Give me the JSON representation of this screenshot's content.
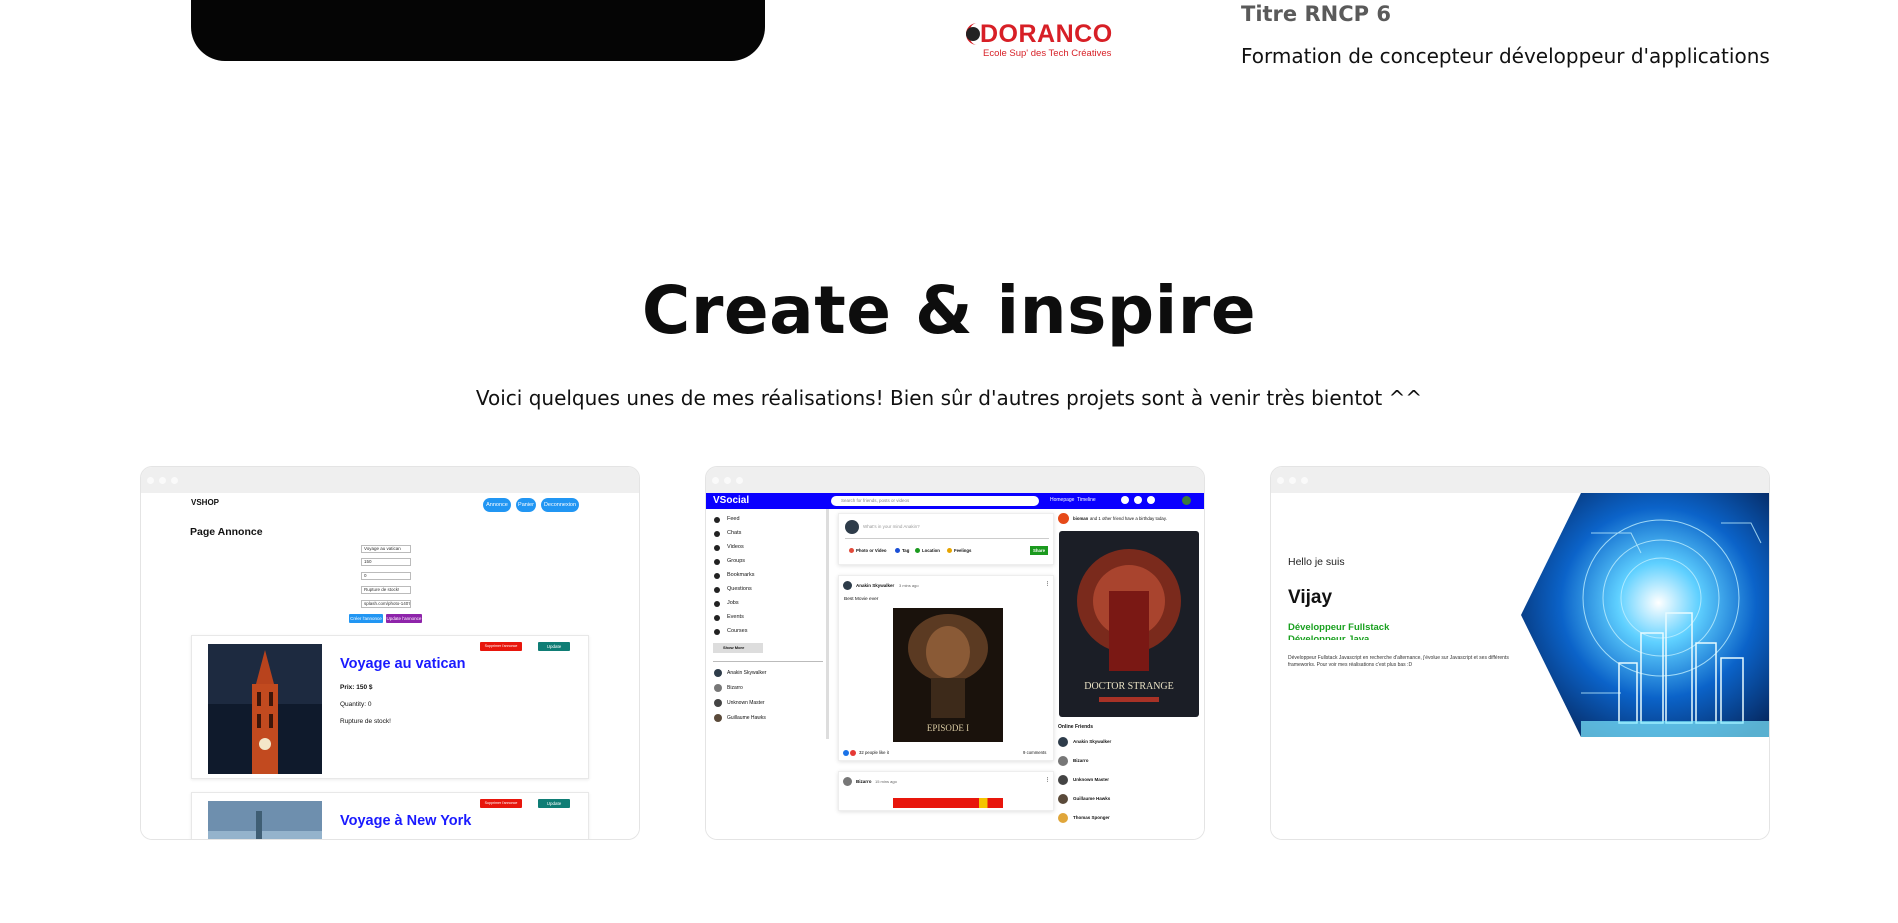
{
  "top": {
    "school_logo_text": "DORANCO",
    "school_logo_tagline": "Ecole Sup' des Tech Créatives",
    "rncp_title": "Titre RNCP 6",
    "rncp_subtitle": "Formation de concepteur développeur d'applications"
  },
  "section": {
    "title": "Create & inspire",
    "subtitle": "Voici quelques unes de mes réalisations! Bien sûr d'autres projets sont à venir très bientot ^^"
  },
  "projects": [
    {
      "brand": "VSHOP",
      "nav": [
        "Annonce",
        "Panier",
        "Deconnexion"
      ],
      "page_title": "Page Annonce",
      "form_values": [
        "Voyage au vatican",
        "150",
        "0",
        "Rupture de stock!",
        "splash.com/photo-1407"
      ],
      "form_buttons": [
        "Créer l'annonce",
        "Update l'annonce"
      ],
      "items": [
        {
          "title": "Voyage au vatican",
          "price": "Prix: 150 $",
          "quantity": "Quantity: 0",
          "stock": "Rupture de stock!",
          "delete": "Supprimer l'annonce",
          "update": "Update"
        },
        {
          "title": "Voyage à New York",
          "delete": "Supprimer l'annonce",
          "update": "Update"
        }
      ]
    },
    {
      "brand": "VSocial",
      "search_placeholder": "Search for friends, posts or videos",
      "nav": [
        "Homepage",
        "Timeline"
      ],
      "sidebar": [
        "Feed",
        "Chats",
        "Videos",
        "Groups",
        "Bookmarks",
        "Questions",
        "Jobs",
        "Events",
        "Courses"
      ],
      "show_more": "Show More",
      "sidebar_friends": [
        "Anakin Skywalker",
        "Bizarro",
        "Unknown Master",
        "Guillaume Hawks"
      ],
      "share_placeholder": "What's in your mind Anakin?",
      "share_options": [
        "Photo or Video",
        "Tag",
        "Location",
        "Feelings"
      ],
      "share_button": "Share",
      "post": {
        "author": "Anakin Skywalker",
        "time": "3 mins ago",
        "text": "Best Movie ever",
        "likes": "32 people like it",
        "comments": "9 comments"
      },
      "post2": {
        "author": "Bizarro",
        "time": "15 mins ago"
      },
      "birthday": {
        "name": "bioman",
        "rest": "and 1 other friend have a birthday today."
      },
      "online_title": "Online Friends",
      "online_friends": [
        "Anakin Skywalker",
        "Bizarro",
        "Unknown Master",
        "Guillaume Hawks",
        "Thomas Sponger"
      ],
      "poster_title": "DOCTOR STRANGE",
      "poster_episode": "EPISODE I"
    },
    {
      "hello": "Hello je suis",
      "name": "Vijay",
      "role": "Développeur Fullstack",
      "role2": "Développeur Java",
      "description": "Développeur Fullstack Javascript en recherche d'alternance, j'évolue sur Javascript et ses différents frameworks. Pour voir mes réalisations c'est plus bas :D"
    }
  ],
  "colors": {
    "logo_red": "#d71f26",
    "vshop_blue": "#2196f3",
    "vsocial_blue": "#0a00ff",
    "vijay_green": "#19a01f"
  }
}
